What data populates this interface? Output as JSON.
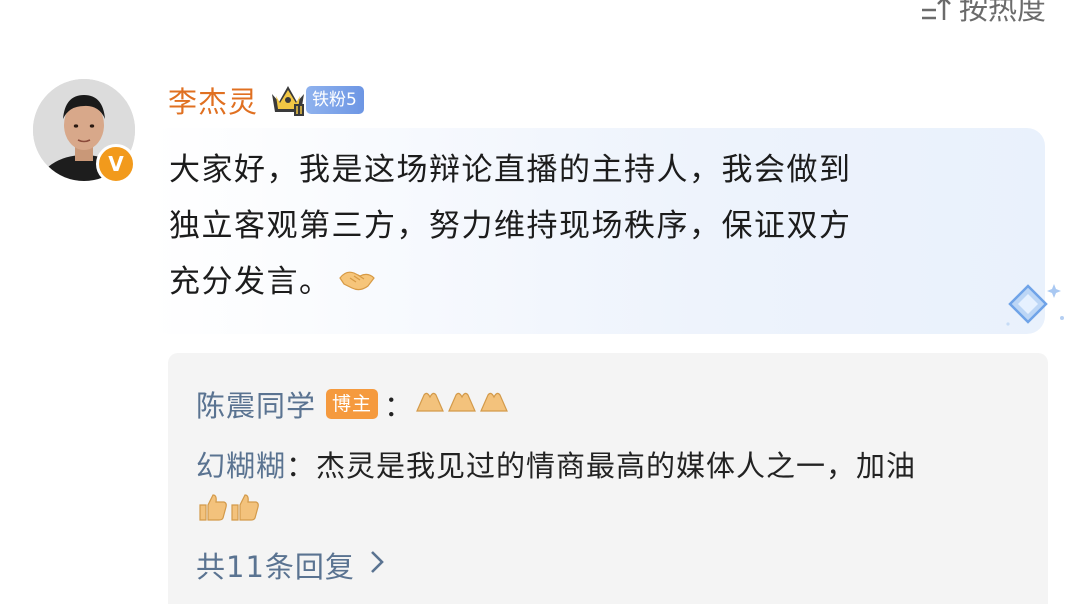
{
  "header": {
    "sort_label": "按热度"
  },
  "comment": {
    "user_name": "李杰灵",
    "fan_badge": "铁粉5",
    "verified_mark": "V",
    "lines": [
      "大家好，我是这场辩论直播的主持人，我会做到",
      "独立客观第三方，努力维持现场秩序，保证双方",
      "充分发言。"
    ],
    "emoji": "handshake-icon"
  },
  "replies": [
    {
      "name": "陈震同学",
      "badge": "博主",
      "separator": "：",
      "emojis": [
        "pray-hands-icon",
        "pray-hands-icon",
        "pray-hands-icon"
      ]
    },
    {
      "name": "幻糊糊",
      "separator": "：",
      "text": "杰灵是我见过的情商最高的媒体人之一，加油",
      "emojis": [
        "thumbs-up-icon",
        "thumbs-up-icon"
      ]
    }
  ],
  "reply_summary": "共11条回复",
  "colors": {
    "username": "#e07021",
    "reply_name": "#5a7391",
    "host_badge": "#f59a3e",
    "fan_badge": "#6d96e4"
  }
}
